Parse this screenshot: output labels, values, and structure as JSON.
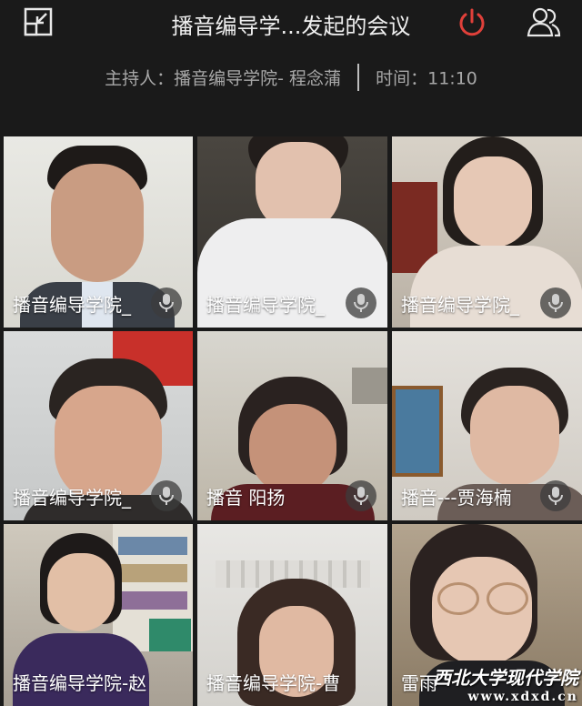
{
  "header": {
    "title": "播音编导学...发起的会议",
    "minimize_icon": "minimize-window-icon",
    "power_icon": "power-leave-icon",
    "participants_icon": "participants-icon",
    "power_color": "#e0403a"
  },
  "info": {
    "host": "主持人：播音编导学院- 程念蒲",
    "time": "时间：11:10"
  },
  "participants": [
    {
      "label": "播音编导学院_",
      "mic": true
    },
    {
      "label": "播音编导学院_",
      "mic": true
    },
    {
      "label": "播音编导学院_",
      "mic": true
    },
    {
      "label": "播音编导学院_",
      "mic": true
    },
    {
      "label": "播音 阳扬",
      "mic": true
    },
    {
      "label": "播音---贾海楠",
      "mic": true
    },
    {
      "label": "播音编导学院-赵",
      "mic": false
    },
    {
      "label": "播音编导学院-曹",
      "mic": false
    },
    {
      "label": "雷雨",
      "mic": false
    }
  ],
  "watermark": {
    "text": "西北大学现代学院",
    "url": "www.xdxd.cn"
  }
}
